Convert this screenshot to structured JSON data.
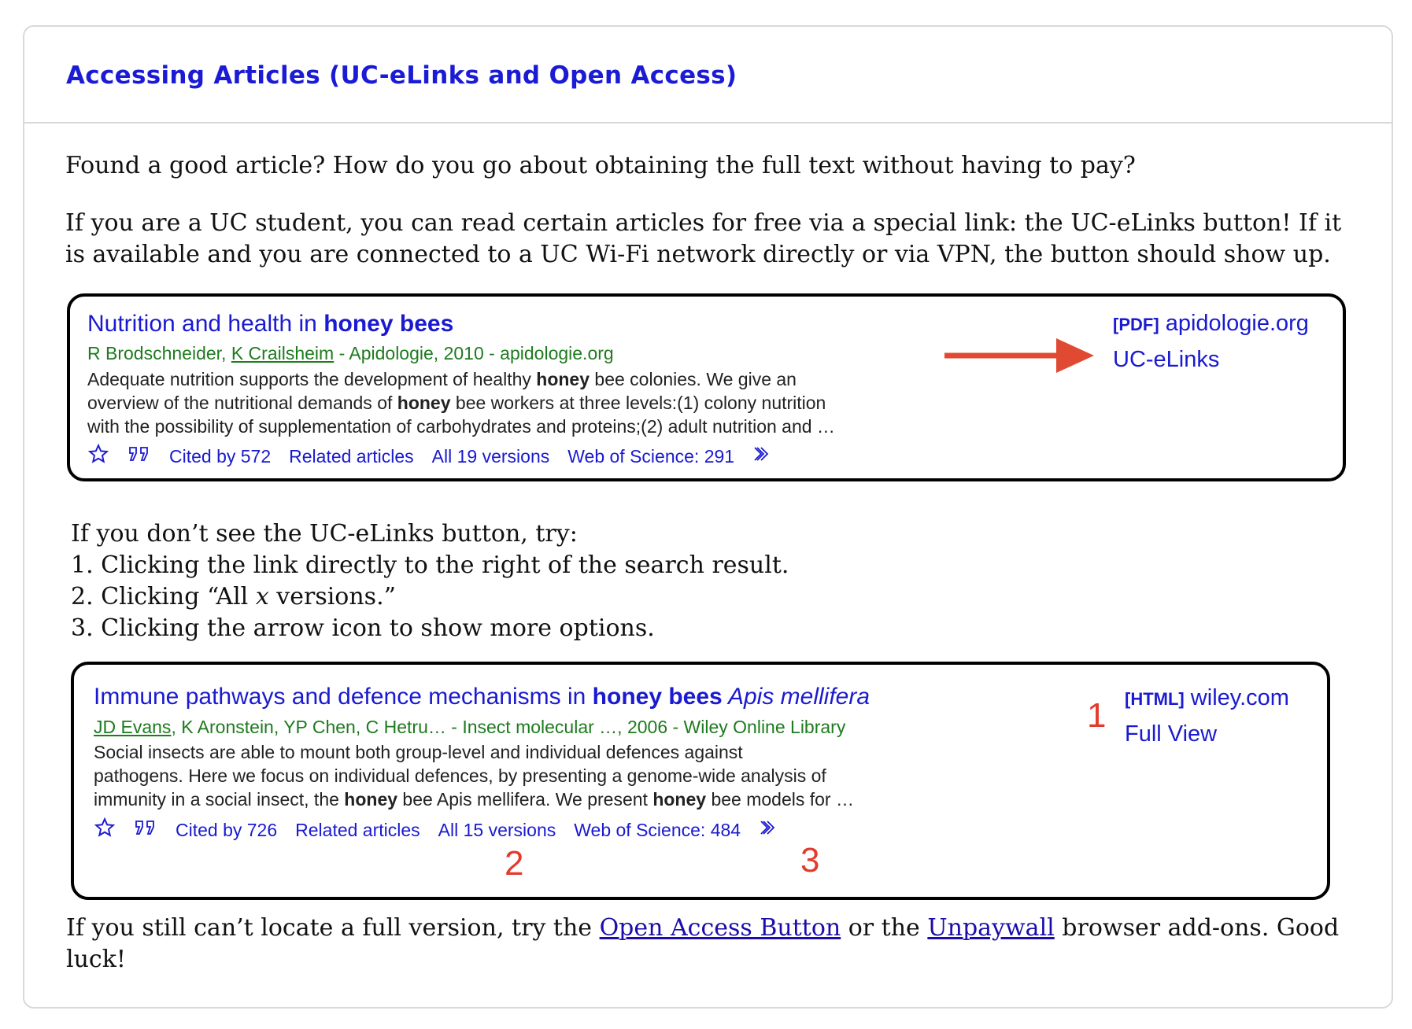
{
  "header": {
    "title": "Accessing Articles (UC-eLinks and Open Access)"
  },
  "intro": {
    "p1": "Found a good article? How do you go about obtaining the full text without having to pay?",
    "p2": "If you are a UC student, you can read certain articles for free via a special link: the UC-eLinks button! If it is available and you are connected to a UC Wi-Fi network directly or via VPN, the button should show up."
  },
  "result1": {
    "title_pre": "Nutrition and health in ",
    "title_bold": "honey bees",
    "authors_a": "R Brodschneider, ",
    "authors_link": "K Crailsheim",
    "authors_b": " - Apidologie, 2010 - apidologie.org",
    "snippet": [
      [
        "Adequate nutrition supports the development of healthy ",
        "honey",
        " bee colonies. We give an"
      ],
      [
        "overview of the nutritional demands of ",
        "honey",
        " bee workers at three levels:(1) colony nutrition"
      ],
      [
        "with the possibility of supplementation of carbohydrates and proteins;(2) adult nutrition and …",
        "",
        ""
      ]
    ],
    "cited_by": "Cited by 572",
    "related": "Related articles",
    "versions": "All 19 versions",
    "wos": "Web of Science: 291",
    "side_tag": "[PDF]",
    "side_source": " apidologie.org",
    "side_link": "UC-eLinks",
    "arrow_color": "#e04a33"
  },
  "tips": {
    "intro": "If you don’t see the UC-eLinks button, try:",
    "item1": "1. Clicking the link directly to the right of the search result.",
    "item2_pre": "2. Clicking “All ",
    "item2_var": "x",
    "item2_post": " versions.”",
    "item3": "3. Clicking the arrow icon to show more options."
  },
  "result2": {
    "title_pre": "Immune pathways and defence mechanisms in ",
    "title_bold": "honey bees",
    "title_italic": " Apis mellifera",
    "authors_link": "JD Evans",
    "authors_b": ", K Aronstein, YP Chen, C Hetru… - Insect molecular …, 2006 - Wiley Online Library",
    "snippet": [
      [
        "Social insects are able to mount both group-level and individual defences against",
        "",
        ""
      ],
      [
        "pathogens. Here we focus on individual defences, by presenting a genome-wide analysis of",
        "",
        ""
      ],
      [
        "immunity in a social insect, the ",
        "honey",
        " bee Apis mellifera. We present "
      ]
    ],
    "snippet_tail_bold": "honey",
    "snippet_tail": " bee models for …",
    "cited_by": "Cited by 726",
    "related": "Related articles",
    "versions": "All 15 versions",
    "wos": "Web of Science: 484",
    "side_tag": "[HTML]",
    "side_source": " wiley.com",
    "side_link": "Full View",
    "marker1": "1",
    "marker2": "2",
    "marker3": "3"
  },
  "closing": {
    "pre": "If you still can’t locate a full version, try the ",
    "link1": "Open Access Button",
    "mid": " or the ",
    "link2": "Unpaywall",
    "post": " browser add-ons. Good luck!"
  }
}
